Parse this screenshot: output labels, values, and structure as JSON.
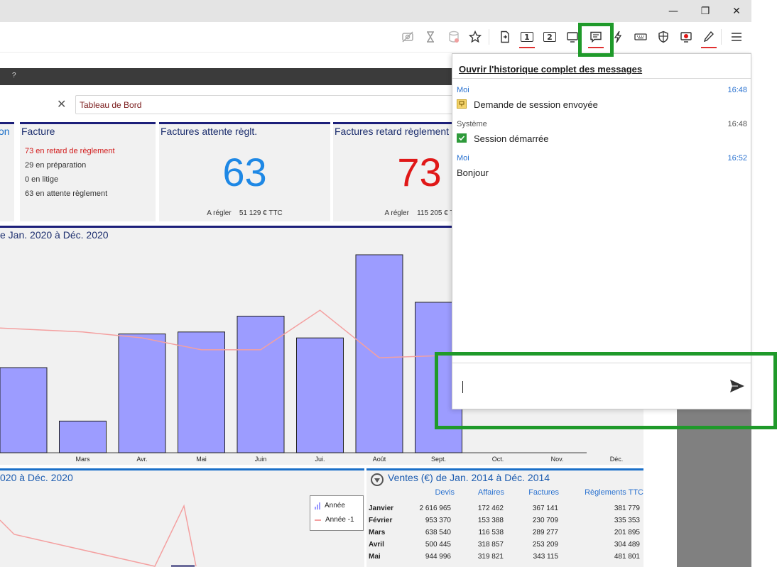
{
  "window_controls": {
    "minimize": "—",
    "restore": "❐",
    "close": "✕"
  },
  "toolbar_icons": [
    "eye-off-icon",
    "hourglass-icon",
    "database-icon",
    "star-icon",
    "file-transfer-icon",
    "monitor-1-icon",
    "monitor-2-icon",
    "monitor-icon",
    "chat-icon",
    "lightning-icon",
    "keyboard-icon",
    "shield-icon",
    "record-icon",
    "pen-icon",
    "menu-icon"
  ],
  "toolbar_labels": {
    "monitor1": "1",
    "monitor2": "2"
  },
  "app": {
    "darkbar_text": "?",
    "search_value": "Tableau de Bord",
    "cards": {
      "cut": {
        "title": "on"
      },
      "facture": {
        "title": "Facture",
        "lines": [
          "73 en retard de règlement",
          "29 en préparation",
          "0 en litige",
          "63 en attente règlement"
        ]
      },
      "attente": {
        "title": "Factures attente règlt.",
        "value": "63",
        "label": "A régler",
        "amount": "51 129 € TTC",
        "color": "#1e88e5"
      },
      "retard": {
        "title": "Factures retard règlement",
        "value": "73",
        "label": "A régler",
        "amount": "115 205 € T",
        "color": "#e01818"
      }
    },
    "chart_title": "e Jan. 2020 à Déc. 2020",
    "bottom_left_title": "020 à Déc. 2020",
    "legend": {
      "annee": "Année",
      "annee_prev": "Année -1"
    },
    "sales_table": {
      "title": "Ventes (€) de Jan. 2014 à Déc. 2014",
      "headers": [
        "Devis",
        "Affaires",
        "Factures",
        "Règlements TTC"
      ],
      "rows": [
        {
          "month": "Janvier",
          "values": [
            "2 616 965",
            "172 462",
            "367 141",
            "381 779"
          ]
        },
        {
          "month": "Février",
          "values": [
            "953 370",
            "153 388",
            "230 709",
            "335 353"
          ]
        },
        {
          "month": "Mars",
          "values": [
            "638 540",
            "116 538",
            "289 277",
            "201 895"
          ]
        },
        {
          "month": "Avril",
          "values": [
            "500 445",
            "318 857",
            "253 209",
            "304 489"
          ]
        },
        {
          "month": "Mai",
          "values": [
            "944 996",
            "319 821",
            "343 115",
            "481 801"
          ]
        }
      ]
    }
  },
  "chart_data": [
    {
      "type": "bar",
      "title": "e Jan. 2020 à Déc. 2020",
      "categories": [
        "",
        "Mars",
        "Avr.",
        "Mai",
        "Juin",
        "Jui.",
        "Août",
        "Sept.",
        "Oct.",
        "Nov.",
        "Déc."
      ],
      "series": [
        {
          "type": "bar",
          "color": "#9c9cff",
          "values": [
            43,
            16,
            60,
            61,
            69,
            58,
            100,
            76,
            0,
            0,
            0
          ]
        },
        {
          "type": "line",
          "color": "#f4a0a0",
          "values": [
            63,
            61,
            58,
            52,
            52,
            72,
            48,
            49,
            57,
            62,
            0
          ]
        }
      ],
      "ylim": [
        0,
        100
      ],
      "grid": false
    },
    {
      "type": "line",
      "title": "020 à Déc. 2020",
      "series": [
        {
          "name": "Année -1",
          "color": "#f4a0a0",
          "values": [
            50,
            15,
            0,
            80,
            0
          ]
        }
      ],
      "legend": "top-right"
    }
  ],
  "messages_panel": {
    "history_link": "Ouvrir l'historique complet des messages",
    "messages": [
      {
        "sender": "Moi",
        "time": "16:48",
        "text": "Demande de session envoyée",
        "icon": "session-request-icon"
      },
      {
        "sender": "Système",
        "time": "16:48",
        "text": "Session démarrée",
        "icon": "check-icon"
      },
      {
        "sender": "Moi",
        "time": "16:52",
        "text": "Bonjour",
        "icon": ""
      }
    ],
    "input_value": "",
    "colors": {
      "me": "#2a72d0",
      "system": "#555555"
    }
  }
}
